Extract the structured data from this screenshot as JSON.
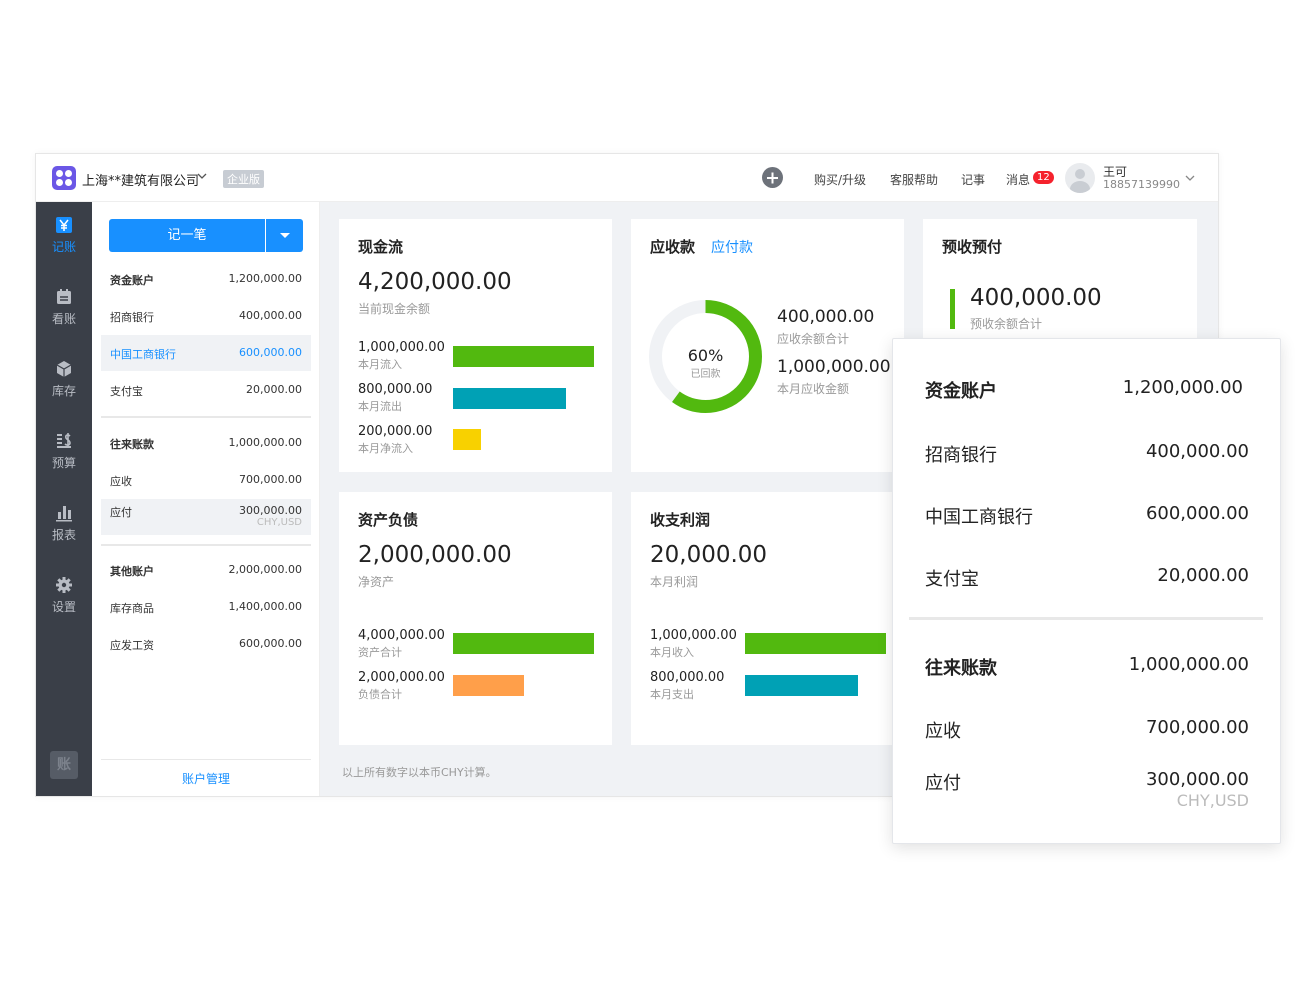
{
  "header": {
    "company": "上海**建筑有限公司",
    "edition": "企业版",
    "links": [
      "购买/升级",
      "客服帮助",
      "记事",
      "消息"
    ],
    "message_count": "12",
    "user_name": "王可",
    "user_phone": "18857139990"
  },
  "nav": {
    "items": [
      {
        "label": "记账",
        "icon": "yen-icon",
        "active": true
      },
      {
        "label": "看账",
        "icon": "ledger-icon",
        "active": false
      },
      {
        "label": "库存",
        "icon": "box-icon",
        "active": false
      },
      {
        "label": "预算",
        "icon": "budget-icon",
        "active": false
      },
      {
        "label": "报表",
        "icon": "bar-chart-icon",
        "active": false
      },
      {
        "label": "设置",
        "icon": "gear-icon",
        "active": false
      }
    ],
    "bottom_logo": "账"
  },
  "panel": {
    "record_button": "记一笔",
    "groups": [
      [
        {
          "name": "资金账户",
          "value": "1,200,000.00",
          "bold": true
        },
        {
          "name": "招商银行",
          "value": "400,000.00"
        },
        {
          "name": "中国工商银行",
          "value": "600,000.00",
          "selected": true
        },
        {
          "name": "支付宝",
          "value": "20,000.00"
        }
      ],
      [
        {
          "name": "往来账款",
          "value": "1,000,000.00",
          "bold": true
        },
        {
          "name": "应收",
          "value": "700,000.00"
        },
        {
          "name": "应付",
          "value": "300,000.00",
          "sub": "CHY,USD",
          "hover": true
        }
      ],
      [
        {
          "name": "其他账户",
          "value": "2,000,000.00",
          "bold": true
        },
        {
          "name": "库存商品",
          "value": "1,400,000.00"
        },
        {
          "name": "应发工资",
          "value": "600,000.00"
        }
      ]
    ],
    "manage_link": "账户管理"
  },
  "cards": {
    "cashflow": {
      "title": "现金流",
      "total": "4,200,000.00",
      "total_label": "当前现金余额",
      "bars": [
        {
          "amount": "1,000,000.00",
          "label": "本月流入",
          "value": 1000000,
          "color": "#52b90f"
        },
        {
          "amount": "800,000.00",
          "label": "本月流出",
          "value": 800000,
          "color": "#00a1b5"
        },
        {
          "amount": "200,000.00",
          "label": "本月净流入",
          "value": 200000,
          "color": "#f8d100"
        }
      ]
    },
    "receivable": {
      "title": "应收款",
      "tab": "应付款",
      "percent": 60,
      "percent_text": "60%",
      "percent_label": "已回款",
      "balance": "400,000.00",
      "balance_label": "应收余额合计",
      "monthly": "1,000,000.00",
      "monthly_label": "本月应收金额",
      "color": "#52b90f"
    },
    "prepaid": {
      "title": "预收预付",
      "total": "400,000.00",
      "total_label": "预收余额合计"
    },
    "assets": {
      "title": "资产负债",
      "total": "2,000,000.00",
      "total_label": "净资产",
      "bars": [
        {
          "amount": "4,000,000.00",
          "label": "资产合计",
          "value": 4000000,
          "color": "#52b90f"
        },
        {
          "amount": "2,000,000.00",
          "label": "负债合计",
          "value": 2000000,
          "color": "#ff9f4a"
        }
      ]
    },
    "profit": {
      "title": "收支利润",
      "total": "20,000.00",
      "total_label": "本月利润",
      "bars": [
        {
          "amount": "1,000,000.00",
          "label": "本月收入",
          "value": 1000000,
          "color": "#52b90f"
        },
        {
          "amount": "800,000.00",
          "label": "本月支出",
          "value": 800000,
          "color": "#00a1b5"
        }
      ]
    }
  },
  "footnote": "以上所有数字以本币CHY计算。",
  "float": {
    "rows": [
      {
        "name": "资金账户",
        "value": "1,200,000.00",
        "bold": true
      },
      {
        "name": "招商银行",
        "value": "400,000.00"
      },
      {
        "name": "中国工商银行",
        "value": "600,000.00"
      },
      {
        "name": "支付宝",
        "value": "20,000.00"
      },
      {
        "name": "往来账款",
        "value": "1,000,000.00",
        "bold": true
      },
      {
        "name": "应收",
        "value": "700,000.00"
      },
      {
        "name": "应付",
        "value": "300,000.00",
        "sub": "CHY,USD"
      }
    ]
  }
}
